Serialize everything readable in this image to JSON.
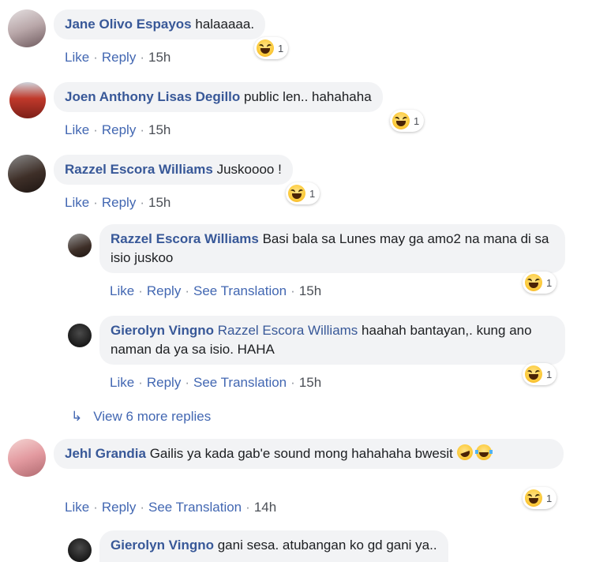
{
  "comments": [
    {
      "name": "Jane Olivo Espayos",
      "text": " halaaaaa.",
      "like": "Like",
      "reply": "Reply",
      "time": "15h",
      "reaction_count": "1"
    },
    {
      "name": "Joen Anthony Lisas Degillo",
      "text": " public len.. hahahaha",
      "like": "Like",
      "reply": "Reply",
      "time": "15h",
      "reaction_count": "1"
    },
    {
      "name": "Razzel Escora Williams",
      "text": " Juskoooo !",
      "like": "Like",
      "reply": "Reply",
      "time": "15h",
      "reaction_count": "1"
    },
    {
      "name": "Razzel Escora Williams",
      "text": " Basi bala sa Lunes may ga amo2 na mana di sa isio juskoo",
      "like": "Like",
      "reply": "Reply",
      "translate": "See Translation",
      "time": "15h",
      "reaction_count": "1"
    },
    {
      "name": "Gierolyn Vingno",
      "tag": "Razzel Escora Williams",
      "text": " haahah bantayan,. kung ano naman da ya sa isio. HAHA",
      "like": "Like",
      "reply": "Reply",
      "translate": "See Translation",
      "time": "15h",
      "reaction_count": "1"
    },
    {
      "name": "Jehl Grandia",
      "text": " Gailis ya kada gab'e sound mong hahahaha bwesit",
      "like": "Like",
      "reply": "Reply",
      "translate": "See Translation",
      "time": "14h",
      "reaction_count": "1"
    },
    {
      "name": "Gierolyn Vingno",
      "text": " gani sesa. atubangan ko gd gani ya.."
    }
  ],
  "view_more": "View 6 more replies",
  "icons": {
    "reaction": "haha-reaction-icon",
    "reply_arrow": "reply-arrow-icon",
    "emoji1": "rolling-laughing-emoji",
    "emoji2": "tears-of-joy-emoji"
  },
  "colors": {
    "name": "#385898",
    "link": "#4267b2",
    "bubble": "#f2f3f5"
  }
}
